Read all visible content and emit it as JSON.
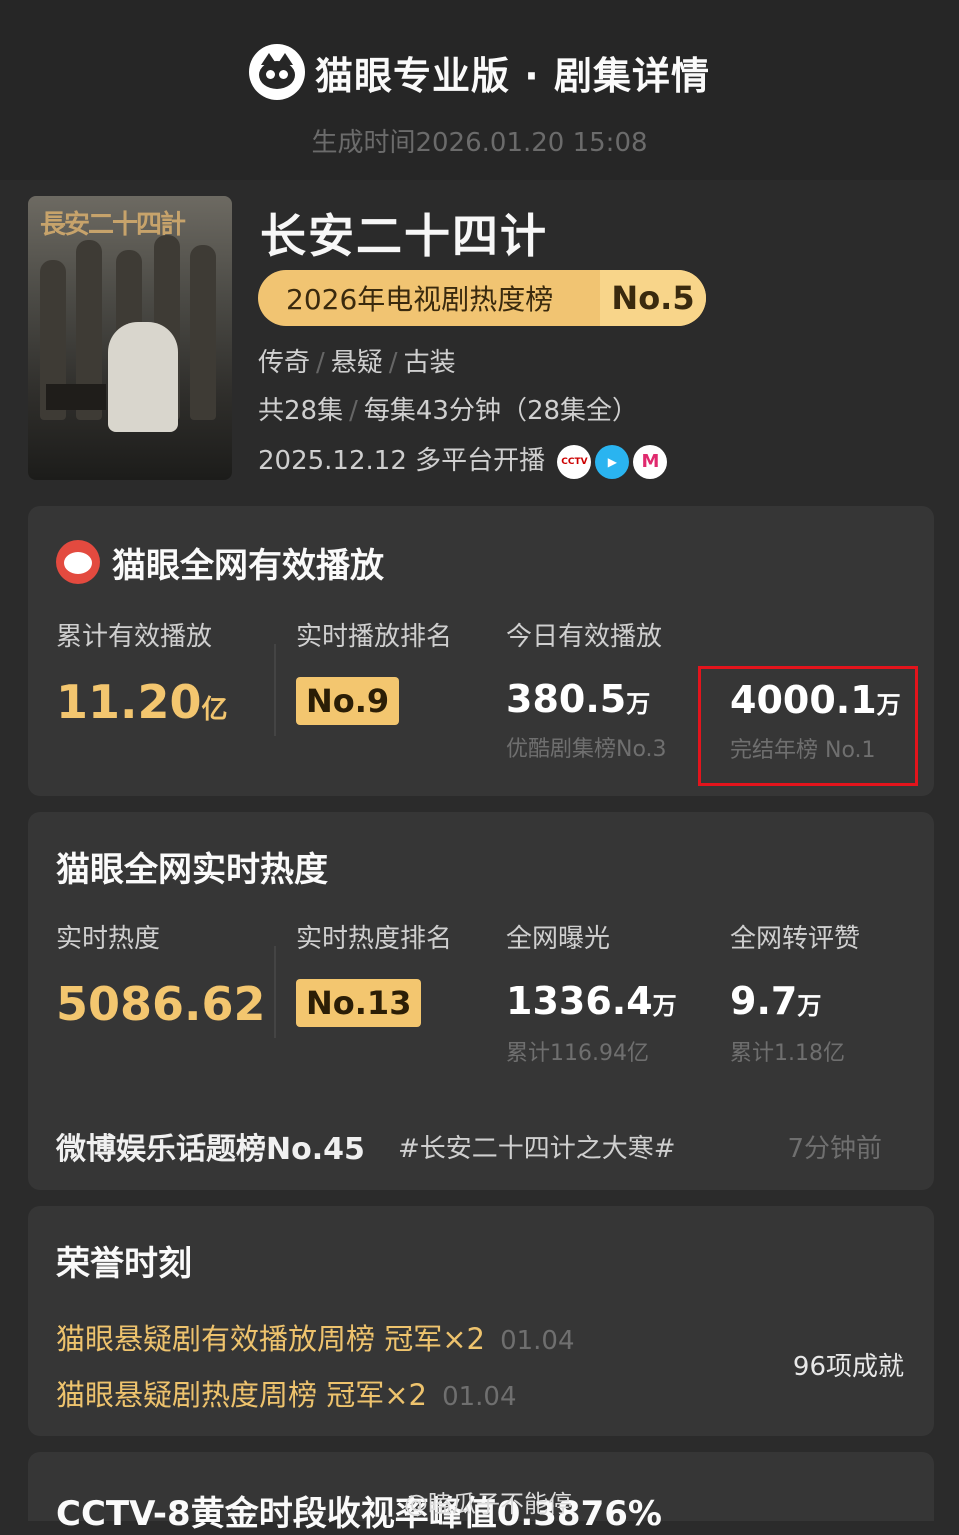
{
  "header": {
    "brand": "猫眼专业版 · 剧集详情",
    "generated": "生成时间2026.01.20 15:08"
  },
  "show": {
    "poster_title": "長安二十四計",
    "title": "长安二十四计",
    "rank_label": "2026年电视剧热度榜",
    "rank_value": "No.5",
    "genres": [
      "传奇",
      "悬疑",
      "古装"
    ],
    "episodes": "共28集",
    "duration": "每集43分钟（28集全）",
    "release": "2025.12.12 多平台开播",
    "platforms": [
      {
        "icon": "cctv-icon",
        "text": "CCTV",
        "color": "#ffffff"
      },
      {
        "icon": "youku-icon",
        "text": "",
        "color": "#2ab4f0"
      },
      {
        "icon": "mgtv-icon",
        "text": "M",
        "color": "#ffffff"
      }
    ]
  },
  "play": {
    "title": "猫眼全网有效播放",
    "cumulative_label": "累计有效播放",
    "cumulative_value": "11.20",
    "cumulative_unit": "亿",
    "rank_label": "实时播放排名",
    "rank_value": "No.9",
    "today_label": "今日有效播放",
    "today_value": "380.5",
    "today_unit": "万",
    "today_sub": "优酷剧集榜No.3",
    "finished_value": "4000.1",
    "finished_unit": "万",
    "finished_sub": "完结年榜 No.1",
    "highlight_color": "#e3141c"
  },
  "heat": {
    "title": "猫眼全网实时热度",
    "heat_label": "实时热度",
    "heat_value": "5086.62",
    "rank_label": "实时热度排名",
    "rank_value": "No.13",
    "exposure_label": "全网曝光",
    "exposure_value": "1336.4",
    "exposure_unit": "万",
    "exposure_sub": "累计116.94亿",
    "engage_label": "全网转评赞",
    "engage_value": "9.7",
    "engage_unit": "万",
    "engage_sub": "累计1.18亿",
    "weibo_rank": "微博娱乐话题榜No.45",
    "weibo_topic": "#长安二十四计之大寒#",
    "weibo_time": "7分钟前"
  },
  "honors": {
    "title": "荣誉时刻",
    "items": [
      {
        "text": "猫眼悬疑剧有效播放周榜 冠军×2",
        "date": "01.04"
      },
      {
        "text": "猫眼悬疑剧热度周榜 冠军×2",
        "date": "01.04"
      }
    ],
    "count": "96项成就"
  },
  "footer": {
    "partial_title": "CCTV-8黄金时段收视率峰值0.3876%",
    "watermark": "@瞌瓜子不能停"
  },
  "colors": {
    "background": "#2b2b2b",
    "card": "#363636",
    "gold": "#f3c66f"
  }
}
